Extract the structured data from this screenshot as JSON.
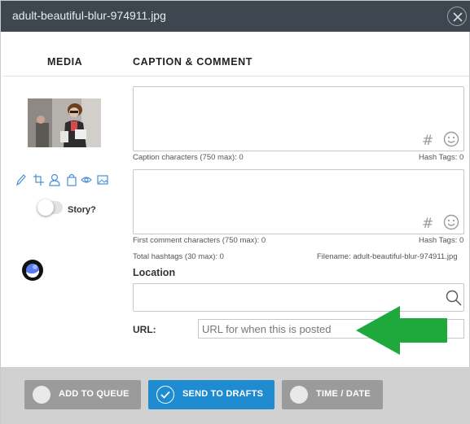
{
  "window": {
    "title": "adult-beautiful-blur-974911.jpg",
    "close_icon": "close-icon"
  },
  "columns": {
    "media": "MEDIA",
    "caption": "CAPTION & COMMENT"
  },
  "media": {
    "tool_icons": [
      "pencil-icon",
      "crop-icon",
      "person-icon",
      "bag-icon",
      "eye-icon",
      "image-icon"
    ],
    "story_label": "Story?",
    "story_enabled": false
  },
  "caption": {
    "counter": "Caption characters (750 max): 0",
    "hashtags": "Hash Tags: 0"
  },
  "comment": {
    "counter": "First comment characters (750 max): 0",
    "hashtags": "Hash Tags: 0"
  },
  "totals": {
    "total_hashtags": "Total hashtags (30 max): 0",
    "filename": "Filename: adult-beautiful-blur-974911.jpg"
  },
  "location": {
    "label": "Location",
    "value": ""
  },
  "url": {
    "label": "URL:",
    "placeholder": "URL for when this is posted",
    "value": ""
  },
  "footer": {
    "add_to_queue": "ADD TO QUEUE",
    "send_to_drafts": "SEND TO DRAFTS",
    "time_date": "TIME / DATE",
    "selected": "send_to_drafts"
  },
  "colors": {
    "titlebar": "#3e4650",
    "accent_blue": "#1f8bd0",
    "tool_icons": "#4a90d9",
    "annotation_arrow": "#1fa83b",
    "footer_bg": "#d1d1d1"
  }
}
